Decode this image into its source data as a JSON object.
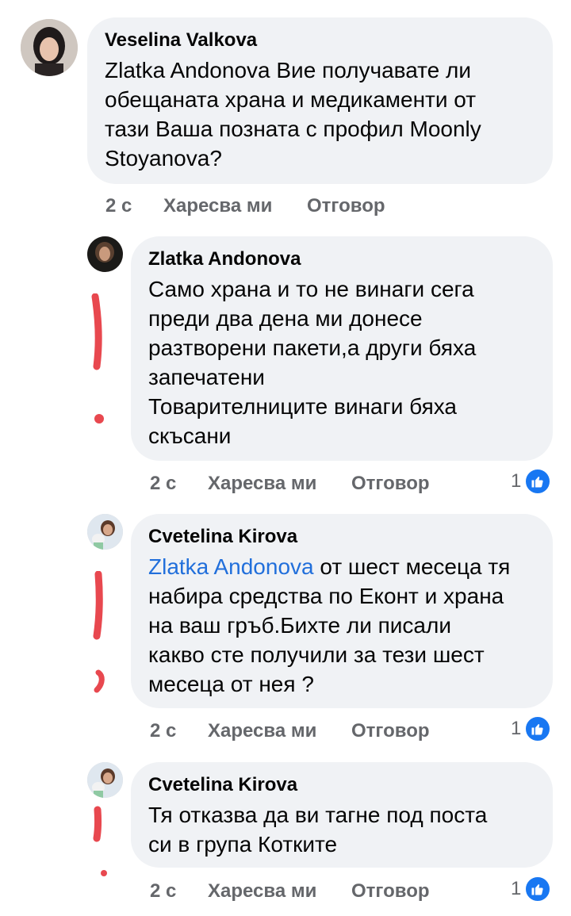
{
  "comments": [
    {
      "author": "Veselina Valkova",
      "text": "Zlatka Andonova Вие получавате ли\nобещаната храна и медикаменти от\nтази Ваша позната с профил Moonly\nStoyanova?",
      "time": "2 с",
      "like": "Харесва ми",
      "reply": "Отговор"
    },
    {
      "author": "Zlatka Andonova",
      "text": "Само храна и то не винаги сега\nпреди два дена ми донесе\nразтворени пакети,а други бяха\nзапечатени\nТоварителниците винаги бяха\nскъсани",
      "time": "2 с",
      "like": "Харесва ми",
      "reply": "Отговор",
      "reaction_count": "1"
    },
    {
      "author": "Cvetelina Kirova",
      "mention": "Zlatka Andonova",
      "text": " от шест месеца тя\nнабира средства по Еконт и храна\nна ваш гръб.Бихте ли писали\nкакво сте получили за тези шест\nмесеца от нея ?",
      "time": "2 с",
      "like": "Харесва ми",
      "reply": "Отговор",
      "reaction_count": "1"
    },
    {
      "author": "Cvetelina Kirova",
      "text": "Тя отказва да ви тагне под поста\nси в група Котките",
      "time": "2 с",
      "like": "Харесва ми",
      "reply": "Отговор",
      "reaction_count": "1"
    }
  ],
  "colors": {
    "bubble": "#f0f2f5",
    "mention": "#216fdb",
    "meta": "#65676b",
    "like_blue": "#1877f2",
    "annotation_red": "#e8484f"
  }
}
